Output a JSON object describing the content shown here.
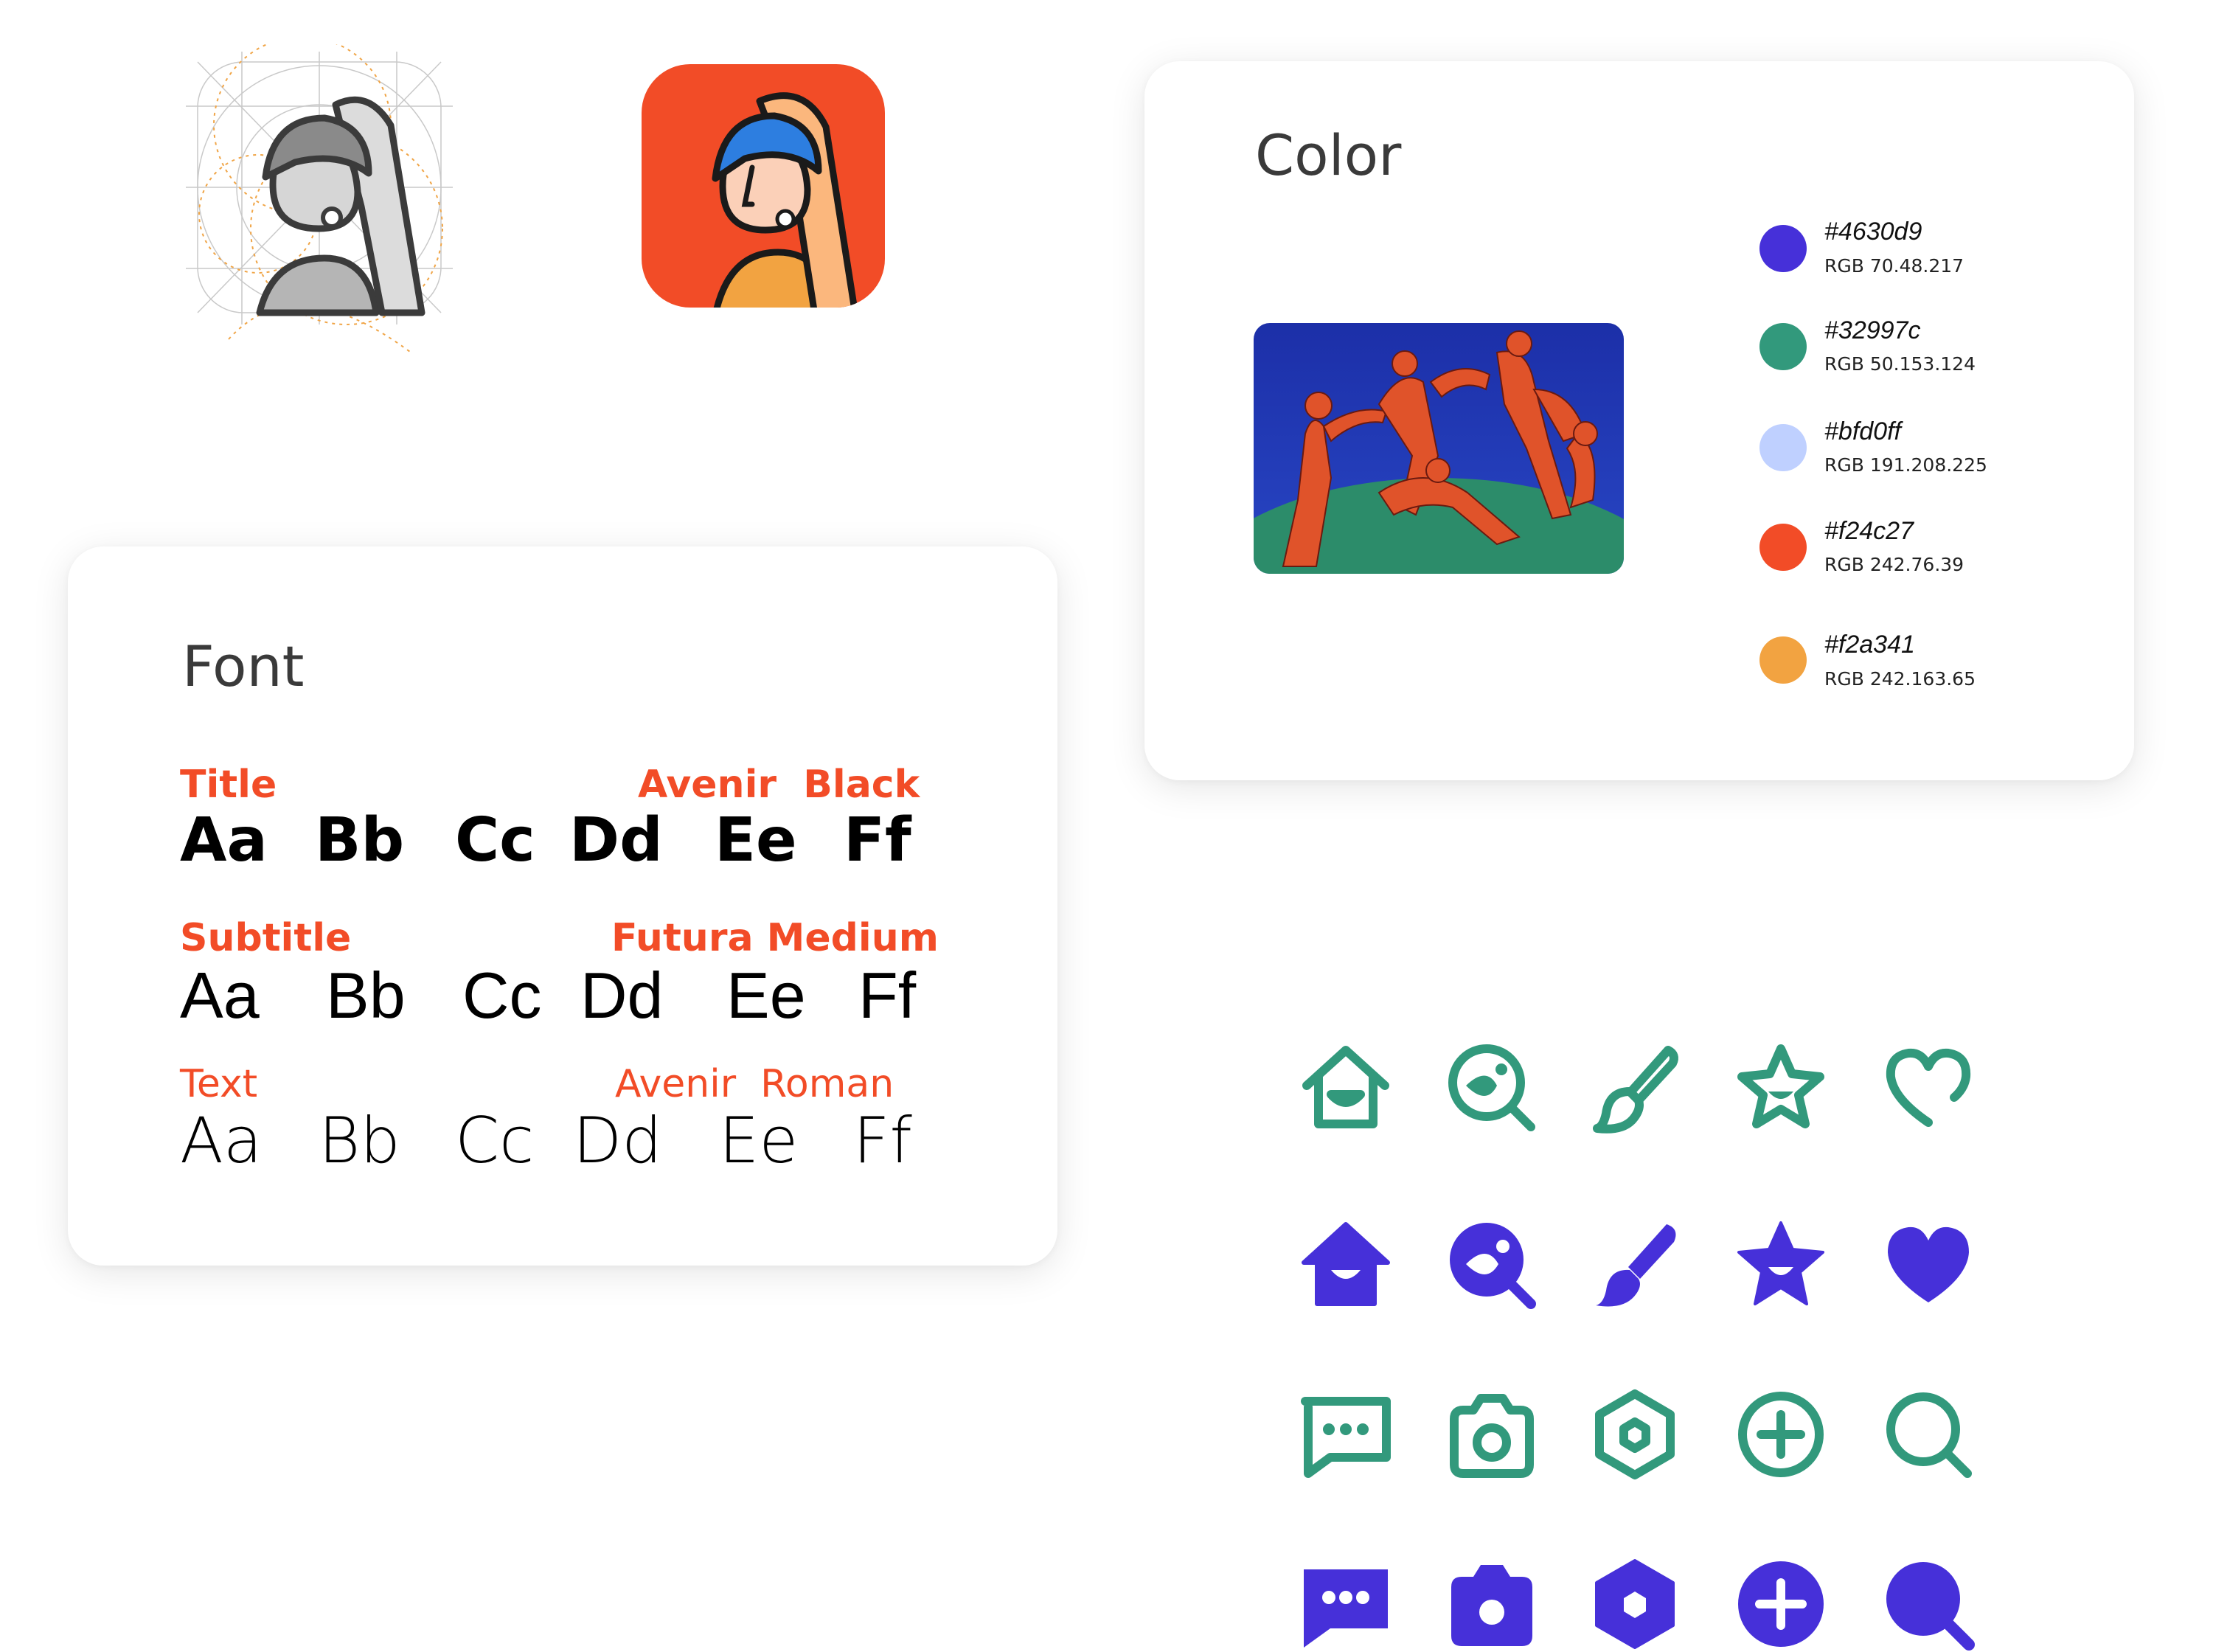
{
  "colors": {
    "accent": "#f24c27",
    "primary": "#4630d9",
    "green": "#32997c",
    "lavender": "#bfd0ff",
    "orange": "#f2a341"
  },
  "app_icons": {
    "sketch": "girl-with-pearl-earring-sketch-icon",
    "final": "girl-with-pearl-earring-app-icon"
  },
  "font_card": {
    "title": "Font",
    "rows": [
      {
        "label": "Title",
        "font": "Avenir  Black",
        "glyphs": [
          "Aa",
          "Bb",
          "Cc",
          "Dd",
          "Ee",
          "Ff"
        ]
      },
      {
        "label": "Subtitle",
        "font": "Futura Medium",
        "glyphs": [
          "Aa",
          "Bb",
          "Cc",
          "Dd",
          "Ee",
          "Ff"
        ]
      },
      {
        "label": "Text",
        "font": "Avenir  Roman",
        "glyphs": [
          "Aa",
          "Bb",
          "Cc",
          "Dd",
          "Ee",
          "Ff"
        ]
      }
    ]
  },
  "color_card": {
    "title": "Color",
    "artwork": "matisse-dance-painting",
    "swatches": [
      {
        "hex": "#4630d9",
        "rgb": "RGB 70.48.217",
        "color": "#4630d9"
      },
      {
        "hex": "#32997c",
        "rgb": "RGB 50.153.124",
        "color": "#32997c"
      },
      {
        "hex": "#bfd0ff",
        "rgb": "RGB 191.208.225",
        "color": "#bfd0ff"
      },
      {
        "hex": "#f24c27",
        "rgb": "RGB 242.76.39",
        "color": "#f24c27"
      },
      {
        "hex": "#f2a341",
        "rgb": "RGB 242.163.65",
        "color": "#f2a341"
      }
    ]
  },
  "icon_set": {
    "row1": [
      "home-outline-icon",
      "discover-outline-icon",
      "brush-outline-icon",
      "star-outline-icon",
      "heart-outline-icon"
    ],
    "row2": [
      "home-filled-icon",
      "discover-filled-icon",
      "brush-filled-icon",
      "star-filled-icon",
      "heart-filled-icon"
    ],
    "row3": [
      "message-outline-icon",
      "camera-outline-icon",
      "settings-outline-icon",
      "add-outline-icon",
      "search-outline-icon"
    ],
    "row4": [
      "message-filled-icon",
      "camera-filled-icon",
      "settings-filled-icon",
      "add-filled-icon",
      "search-filled-icon"
    ]
  }
}
